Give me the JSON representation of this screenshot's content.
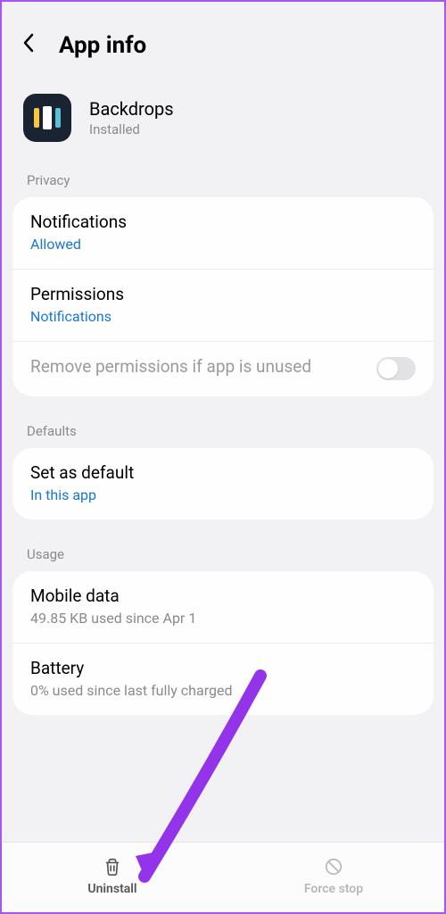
{
  "header": {
    "title": "App info"
  },
  "app": {
    "name": "Backdrops",
    "status": "Installed"
  },
  "sections": {
    "privacy": {
      "label": "Privacy",
      "notifications": {
        "title": "Notifications",
        "value": "Allowed"
      },
      "permissions": {
        "title": "Permissions",
        "value": "Notifications"
      },
      "removeUnused": {
        "title": "Remove permissions if app is unused",
        "enabled": false
      }
    },
    "defaults": {
      "label": "Defaults",
      "setDefault": {
        "title": "Set as default",
        "value": "In this app"
      }
    },
    "usage": {
      "label": "Usage",
      "mobileData": {
        "title": "Mobile data",
        "value": "49.85 KB used since Apr 1"
      },
      "battery": {
        "title": "Battery",
        "value": "0% used since last fully charged"
      }
    }
  },
  "bottomBar": {
    "uninstall": "Uninstall",
    "forceStop": "Force stop"
  }
}
